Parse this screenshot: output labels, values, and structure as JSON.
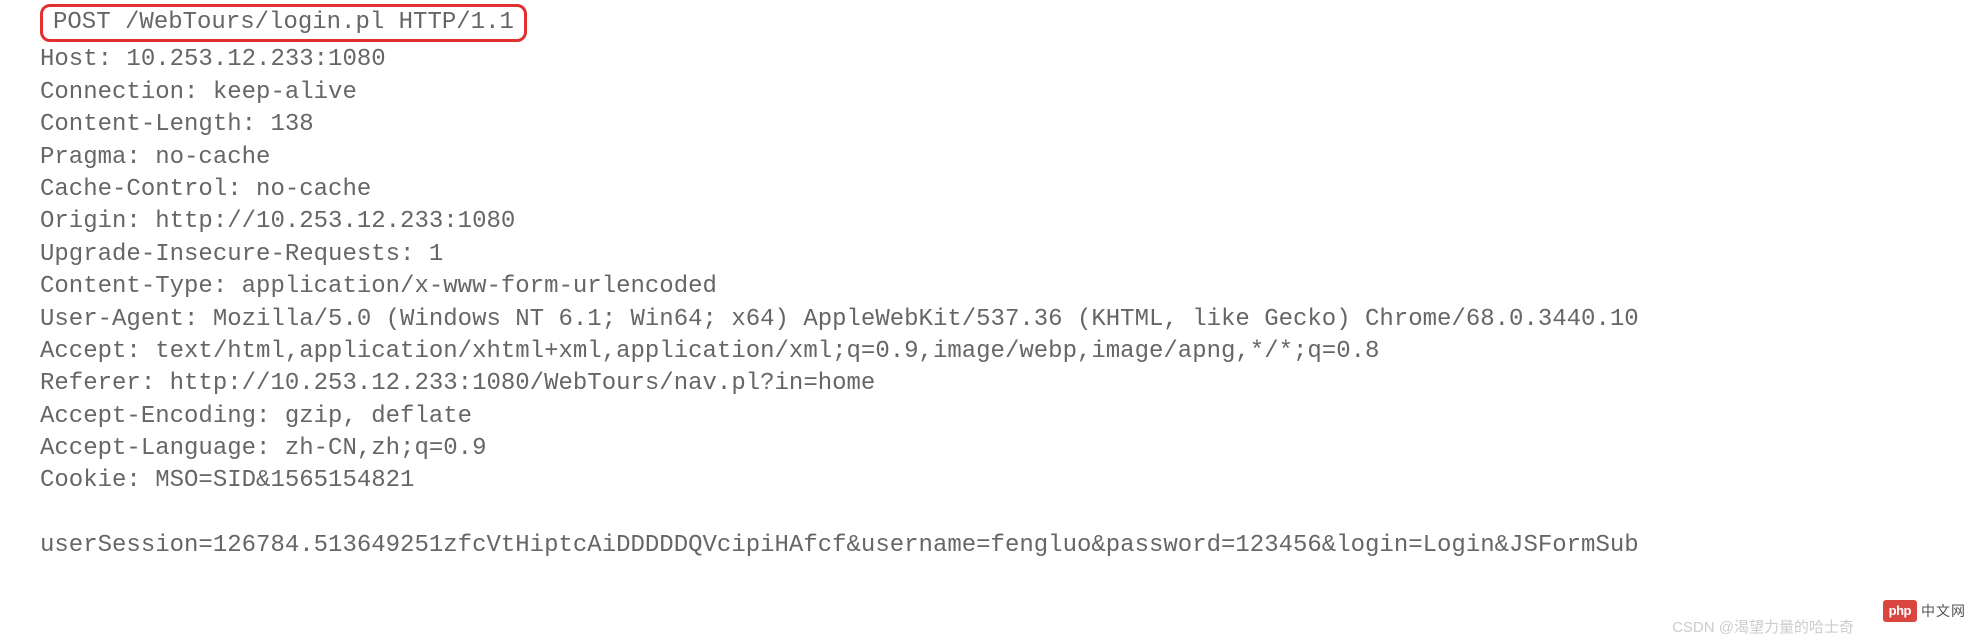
{
  "request_line": "POST /WebTours/login.pl HTTP/1.1",
  "headers": [
    "Host: 10.253.12.233:1080",
    "Connection: keep-alive",
    "Content-Length: 138",
    "Pragma: no-cache",
    "Cache-Control: no-cache",
    "Origin: http://10.253.12.233:1080",
    "Upgrade-Insecure-Requests: 1",
    "Content-Type: application/x-www-form-urlencoded",
    "User-Agent: Mozilla/5.0 (Windows NT 6.1; Win64; x64) AppleWebKit/537.36 (KHTML, like Gecko) Chrome/68.0.3440.10",
    "Accept: text/html,application/xhtml+xml,application/xml;q=0.9,image/webp,image/apng,*/*;q=0.8",
    "Referer: http://10.253.12.233:1080/WebTours/nav.pl?in=home",
    "Accept-Encoding: gzip, deflate",
    "Accept-Language: zh-CN,zh;q=0.9",
    "Cookie: MSO=SID&1565154821"
  ],
  "body": "userSession=126784.513649251zfcVtHiptcAiDDDDDQVcipiHAfcf&username=fengluo&password=123456&login=Login&JSFormSub",
  "watermark": {
    "logo": "php",
    "text": "中文网"
  },
  "csdn": "CSDN @渴望力量的哈士奇"
}
